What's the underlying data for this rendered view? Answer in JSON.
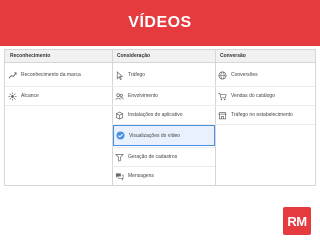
{
  "banner": {
    "title": "VÍDEOS"
  },
  "columns": [
    {
      "header": "Reconhecimento",
      "items": [
        {
          "label": "Reconhecimento da marca",
          "icon": "brand-awareness-icon"
        },
        {
          "label": "Alcance",
          "icon": "reach-icon"
        }
      ]
    },
    {
      "header": "Consideração",
      "items": [
        {
          "label": "Tráfego",
          "icon": "cursor-icon"
        },
        {
          "label": "Envolvimento",
          "icon": "people-icon"
        },
        {
          "label": "Instalações do aplicativo",
          "icon": "box-icon"
        },
        {
          "label": "Visualizações do vídeo",
          "icon": "video-check-icon",
          "selected": true
        },
        {
          "label": "Geração de cadastros",
          "icon": "filter-icon"
        },
        {
          "label": "Mensagens",
          "icon": "chat-icon"
        }
      ]
    },
    {
      "header": "Conversão",
      "items": [
        {
          "label": "Conversões",
          "icon": "globe-icon"
        },
        {
          "label": "Vendas do catálogo",
          "icon": "cart-icon"
        },
        {
          "label": "Tráfego no estabelecimento",
          "icon": "store-icon"
        }
      ]
    }
  ],
  "logo": {
    "text": "RM"
  },
  "colors": {
    "brand": "#e53b3f",
    "selected_border": "#4a90e2",
    "selected_bg": "#e8f1fd"
  }
}
